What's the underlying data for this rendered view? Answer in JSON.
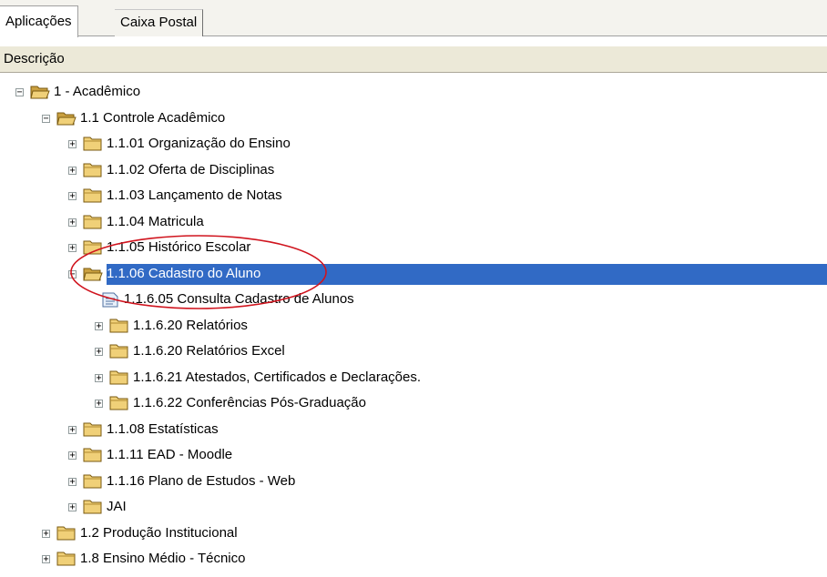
{
  "tabs": [
    {
      "label": "Aplicações"
    },
    {
      "label": "Caixa Postal"
    }
  ],
  "header": {
    "column": "Descrição"
  },
  "tree": [
    {
      "label": "1 - Acadêmico",
      "level": 0,
      "type": "folder-open",
      "expander": "−"
    },
    {
      "label": "1.1 Controle Acadêmico",
      "level": 1,
      "type": "folder-open",
      "expander": "−"
    },
    {
      "label": "1.1.01 Organização do Ensino",
      "level": 2,
      "type": "folder",
      "expander": "+"
    },
    {
      "label": "1.1.02 Oferta de Disciplinas",
      "level": 2,
      "type": "folder",
      "expander": "+"
    },
    {
      "label": "1.1.03 Lançamento de Notas",
      "level": 2,
      "type": "folder",
      "expander": "+"
    },
    {
      "label": "1.1.04 Matricula",
      "level": 2,
      "type": "folder",
      "expander": "+"
    },
    {
      "label": "1.1.05 Histórico Escolar",
      "level": 2,
      "type": "folder",
      "expander": "+"
    },
    {
      "label": "1.1.06 Cadastro do Aluno",
      "level": 2,
      "type": "folder-open",
      "expander": "−",
      "selected": true
    },
    {
      "label": "1.1.6.05 Consulta Cadastro de Alunos",
      "level": 3,
      "type": "document",
      "expander": ""
    },
    {
      "label": "1.1.6.20 Relatórios",
      "level": 3,
      "type": "folder",
      "expander": "+"
    },
    {
      "label": "1.1.6.20 Relatórios Excel",
      "level": 3,
      "type": "folder",
      "expander": "+"
    },
    {
      "label": "1.1.6.21 Atestados, Certificados e Declarações.",
      "level": 3,
      "type": "folder",
      "expander": "+"
    },
    {
      "label": "1.1.6.22 Conferências Pós-Graduação",
      "level": 3,
      "type": "folder",
      "expander": "+"
    },
    {
      "label": "1.1.08 Estatísticas",
      "level": 2,
      "type": "folder",
      "expander": "+"
    },
    {
      "label": "1.1.11 EAD - Moodle",
      "level": 2,
      "type": "folder",
      "expander": "+"
    },
    {
      "label": "1.1.16 Plano de Estudos - Web",
      "level": 2,
      "type": "folder",
      "expander": "+"
    },
    {
      "label": "JAI",
      "level": 2,
      "type": "folder",
      "expander": "+"
    },
    {
      "label": "1.2 Produção Institucional",
      "level": 1,
      "type": "folder",
      "expander": "+"
    },
    {
      "label": "1.8 Ensino Médio - Técnico",
      "level": 1,
      "type": "folder",
      "expander": "+"
    }
  ],
  "colors": {
    "selection": "#316ac5",
    "folder": "#e8c46a",
    "annotation_circle": "#d0141e"
  }
}
